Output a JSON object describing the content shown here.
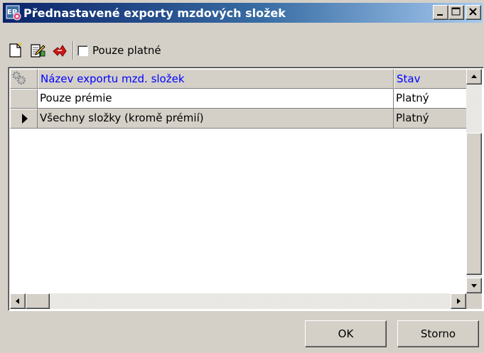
{
  "window": {
    "title": "Přednastavené exporty mzdových složek",
    "app_icon": "ep-app-icon"
  },
  "toolbar": {
    "icons": [
      "new-document-icon",
      "edit-document-icon",
      "delete-icon"
    ],
    "filter_checkbox_label": "Pouze platné",
    "filter_checked": false
  },
  "grid": {
    "columns": [
      "Název exportu mzd. složek",
      "Stav"
    ],
    "rows": [
      {
        "name": "Pouze prémie",
        "stav": "Platný"
      },
      {
        "name": "Všechny složky (kromě prémií)",
        "stav": "Platný"
      }
    ],
    "selected_row": 1
  },
  "buttons": {
    "ok": "OK",
    "cancel": "Storno"
  },
  "colors": {
    "title_gradient_start": "#0a246a",
    "title_gradient_end": "#a6caf0",
    "header_text": "#0000ff",
    "face": "#d4d0c8"
  }
}
